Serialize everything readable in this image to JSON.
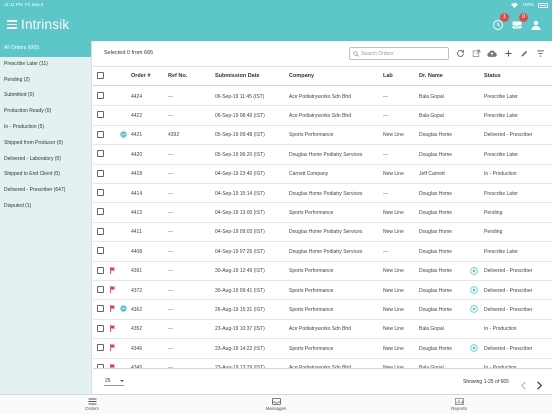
{
  "statusbar": {
    "time": "11:11 PM",
    "date": "Fri Sep 6",
    "battery": "100%"
  },
  "app": {
    "title": "Intrinsik"
  },
  "top_icons": [
    {
      "icon": "notification-icon",
      "badge": "1"
    },
    {
      "icon": "messages-icon",
      "badge": "0"
    },
    {
      "icon": "account-icon",
      "badge": ""
    }
  ],
  "sidebar": {
    "items": [
      {
        "label": "All Orders (665)",
        "active": true
      },
      {
        "label": "Prescribe Later (11)"
      },
      {
        "label": "Pending (2)"
      },
      {
        "label": "Submitted (0)"
      },
      {
        "label": "Production Ready (0)"
      },
      {
        "label": "In - Production (5)"
      },
      {
        "label": "Shipped from Producer (0)"
      },
      {
        "label": "Delivered - Laboratory (0)"
      },
      {
        "label": "Shipped to End Client (0)"
      },
      {
        "label": "Delivered - Prescriber (647)"
      },
      {
        "label": "Disputed (1)"
      }
    ]
  },
  "toolbar": {
    "selected_text": "Selected 0 from 665",
    "search_placeholder": "Search Orders",
    "tools": [
      "refresh-icon",
      "export-icon",
      "upload-cloud-icon",
      "add-icon",
      "edit-icon",
      "filter-icon"
    ]
  },
  "table": {
    "headers": {
      "order": "Order #",
      "ref": "Ref No.",
      "date": "Submission Date",
      "company": "Company",
      "lab": "Lab",
      "dr": "Dr. Name",
      "status": "Status"
    },
    "rows": [
      {
        "order": "4424",
        "ref": "---",
        "date": "06-Sep-19 11:45 (IST)",
        "company": "Ace Podiatryworks Sdn Bhd",
        "lab": "---",
        "dr": "Bala Gopal",
        "status": "Prescribe Later",
        "flag": false,
        "chat": false,
        "ds": false
      },
      {
        "order": "4422",
        "ref": "---",
        "date": "06-Sep-19 08:49 (IST)",
        "company": "Ace Podiatryworks Sdn Bhd",
        "lab": "---",
        "dr": "Bala Gopal",
        "status": "Prescribe Later",
        "flag": false,
        "chat": false,
        "ds": false
      },
      {
        "order": "4421",
        "ref": "4392",
        "date": "05-Sep-19 09:48 (IST)",
        "company": "Sports Performance",
        "lab": "New Line",
        "dr": "Douglas Home",
        "status": "Delivered - Prescriber",
        "flag": false,
        "chat": true,
        "ds": false
      },
      {
        "order": "4420",
        "ref": "---",
        "date": "05-Sep-19 06:20 (IST)",
        "company": "Douglas Home Podiatry Services",
        "lab": "---",
        "dr": "Douglas Home",
        "status": "Prescribe Later",
        "flag": false,
        "chat": false,
        "ds": false
      },
      {
        "order": "4418",
        "ref": "---",
        "date": "04-Sep-19 23:40 (IST)",
        "company": "Carnett Company",
        "lab": "New Line",
        "dr": "Jeff Carnett",
        "status": "In - Production",
        "flag": false,
        "chat": false,
        "ds": false
      },
      {
        "order": "4414",
        "ref": "---",
        "date": "04-Sep-19 15:14 (IST)",
        "company": "Douglas Home Podiatry Services",
        "lab": "---",
        "dr": "Douglas Home",
        "status": "Prescribe Later",
        "flag": false,
        "chat": false,
        "ds": false
      },
      {
        "order": "4413",
        "ref": "---",
        "date": "04-Sep-19 13:00 (IST)",
        "company": "Sports Performance",
        "lab": "New Line",
        "dr": "Douglas Home",
        "status": "Pending",
        "flag": false,
        "chat": false,
        "ds": false
      },
      {
        "order": "4411",
        "ref": "---",
        "date": "04-Sep-19 09:03 (IST)",
        "company": "Douglas Home Podiatry Services",
        "lab": "New Line",
        "dr": "Douglas Home",
        "status": "Pending",
        "flag": false,
        "chat": false,
        "ds": false
      },
      {
        "order": "4408",
        "ref": "---",
        "date": "04-Sep-19 07:25 (IST)",
        "company": "Douglas Home Podiatry Services",
        "lab": "---",
        "dr": "Douglas Home",
        "status": "Prescribe Later",
        "flag": false,
        "chat": false,
        "ds": false
      },
      {
        "order": "4391",
        "ref": "---",
        "date": "30-Aug-19 12:49 (IST)",
        "company": "Sports Performance",
        "lab": "New Line",
        "dr": "Douglas Home",
        "status": "Delivered - Prescriber",
        "flag": true,
        "chat": false,
        "ds": true
      },
      {
        "order": "4372",
        "ref": "---",
        "date": "30-Aug-19 09:41 (IST)",
        "company": "Sports Performance",
        "lab": "New Line",
        "dr": "Douglas Home",
        "status": "Delivered - Prescriber",
        "flag": true,
        "chat": false,
        "ds": true
      },
      {
        "order": "4362",
        "ref": "---",
        "date": "26-Aug-19 15:31 (IST)",
        "company": "Sports Performance",
        "lab": "New Line",
        "dr": "Douglas Home",
        "status": "Delivered - Prescriber",
        "flag": true,
        "chat": true,
        "ds": true
      },
      {
        "order": "4352",
        "ref": "---",
        "date": "23-Aug-19 10:37 (IST)",
        "company": "Ace Podiatryworks Sdn Bhd",
        "lab": "New Line",
        "dr": "Bala Gopal",
        "status": "In - Production",
        "flag": true,
        "chat": false,
        "ds": false
      },
      {
        "order": "4346",
        "ref": "---",
        "date": "23-Aug-19 14:22 (IST)",
        "company": "Sports Performance",
        "lab": "New Line",
        "dr": "Douglas Home",
        "status": "Delivered - Prescriber",
        "flag": true,
        "chat": false,
        "ds": true
      },
      {
        "order": "4345",
        "ref": "---",
        "date": "23-Aug-19 13:29 (IST)",
        "company": "Ace Podiatryworks Sdn Bhd",
        "lab": "New Line",
        "dr": "Bala Gopal",
        "status": "In - Production",
        "flag": true,
        "chat": false,
        "ds": false
      }
    ]
  },
  "footer": {
    "page_size": "25",
    "showing": "Showing 1-25 of 665"
  },
  "bottom_nav": [
    {
      "label": "Orders",
      "icon": "orders-icon"
    },
    {
      "label": "Messages",
      "icon": "messages-icon"
    },
    {
      "label": "Reports",
      "icon": "reports-icon"
    }
  ],
  "colors": {
    "accent": "#5cc6c9",
    "flag": "#e0344a",
    "badge": "#e24a4a",
    "sidebar_bg": "#e4f1f2"
  }
}
